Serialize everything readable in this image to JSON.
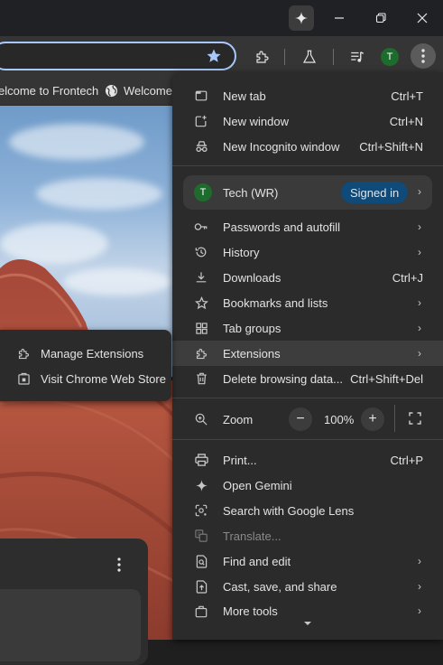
{
  "titlebar": {
    "buttons": [
      "gemini",
      "minimize",
      "restore",
      "close"
    ]
  },
  "toolbar": {
    "icons": [
      "star-icon",
      "extensions-icon",
      "labs-icon",
      "media-icon"
    ],
    "avatar_letter": "T"
  },
  "bookmarks": {
    "items": [
      {
        "label": "elcome to Frontech"
      },
      {
        "label": "Welcome t"
      }
    ]
  },
  "menu": {
    "items": [
      {
        "label": "New tab",
        "shortcut": "Ctrl+T",
        "icon": "new-tab-icon"
      },
      {
        "label": "New window",
        "shortcut": "Ctrl+N",
        "icon": "new-window-icon"
      },
      {
        "label": "New Incognito window",
        "shortcut": "Ctrl+Shift+N",
        "icon": "incognito-icon"
      }
    ],
    "profile": {
      "avatar_letter": "T",
      "name": "Tech (WR)",
      "status": "Signed in"
    },
    "items2": [
      {
        "label": "Passwords and autofill",
        "icon": "key-icon",
        "submenu": true
      },
      {
        "label": "History",
        "icon": "history-icon",
        "submenu": true
      },
      {
        "label": "Downloads",
        "shortcut": "Ctrl+J",
        "icon": "download-icon"
      },
      {
        "label": "Bookmarks and lists",
        "icon": "star-icon",
        "submenu": true
      },
      {
        "label": "Tab groups",
        "icon": "tab-groups-icon",
        "submenu": true
      },
      {
        "label": "Extensions",
        "icon": "extensions-icon",
        "submenu": true
      },
      {
        "label": "Delete browsing data...",
        "shortcut": "Ctrl+Shift+Del",
        "icon": "trash-icon"
      }
    ],
    "zoom": {
      "label": "Zoom",
      "minus": "−",
      "value": "100%",
      "plus": "+"
    },
    "items3": [
      {
        "label": "Print...",
        "shortcut": "Ctrl+P",
        "icon": "print-icon"
      },
      {
        "label": "Open Gemini",
        "icon": "gemini-icon"
      },
      {
        "label": "Search with Google Lens",
        "icon": "lens-icon"
      },
      {
        "label": "Translate...",
        "icon": "translate-icon",
        "disabled": true
      },
      {
        "label": "Find and edit",
        "icon": "find-icon",
        "submenu": true
      },
      {
        "label": "Cast, save, and share",
        "icon": "cast-icon",
        "submenu": true
      },
      {
        "label": "More tools",
        "icon": "tools-icon",
        "submenu": true
      }
    ]
  },
  "submenu": {
    "items": [
      {
        "label": "Manage Extensions",
        "icon": "extensions-icon"
      },
      {
        "label": "Visit Chrome Web Store",
        "icon": "web-store-icon"
      }
    ]
  },
  "colors": {
    "accent": "#a8c7fa",
    "badge": "#0f4a78",
    "avatar": "#1e6b2e"
  }
}
